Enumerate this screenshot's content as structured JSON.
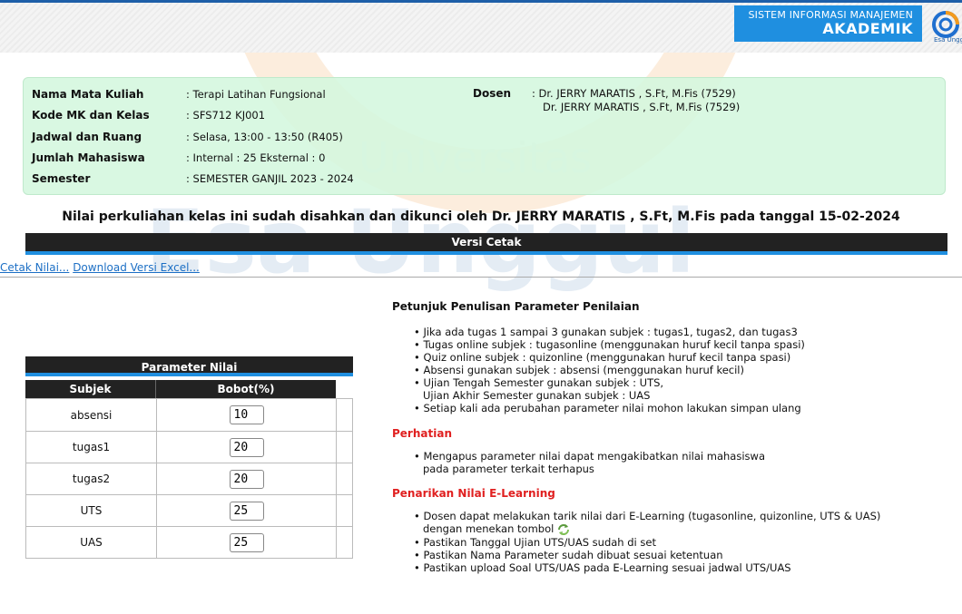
{
  "header": {
    "title_line1": "SISTEM INFORMASI MANAJEMEN",
    "title_line2": "AKADEMIK",
    "logo_text": "Esa Unggul",
    "accent": "#1f8fe0"
  },
  "watermark": {
    "line1": "Universitas",
    "line2": "Esa Unggul"
  },
  "info": {
    "rows": [
      {
        "label": "Nama Mata Kuliah",
        "value": ": Terapi Latihan Fungsional"
      },
      {
        "label": "Kode MK dan Kelas",
        "value": ": SFS712 KJ001"
      },
      {
        "label": "Jadwal dan Ruang",
        "value": ": Selasa, 13:00 - 13:50 (R405)"
      },
      {
        "label": "Jumlah Mahasiswa",
        "value": ": Internal : 25 Eksternal : 0"
      },
      {
        "label": "Semester",
        "value": ": SEMESTER GANJIL 2023 - 2024"
      }
    ],
    "dosen_label": "Dosen",
    "dosen_line1": ": Dr. JERRY MARATIS , S.Ft, M.Fis (7529)",
    "dosen_line2": "Dr. JERRY MARATIS , S.Ft, M.Fis (7529)"
  },
  "locked_message": "Nilai perkuliahan kelas ini sudah disahkan dan dikunci oleh Dr. JERRY MARATIS , S.Ft, M.Fis pada tanggal 15-02-2024",
  "versi_cetak": {
    "title": "Versi Cetak",
    "link_cetak": "Cetak Nilai...",
    "link_excel": "Download Versi Excel..."
  },
  "parameter": {
    "title": "Parameter Nilai",
    "col_subjek": "Subjek",
    "col_bobot": "Bobot(%)",
    "rows": [
      {
        "subjek": "absensi",
        "bobot": "10"
      },
      {
        "subjek": "tugas1",
        "bobot": "20"
      },
      {
        "subjek": "tugas2",
        "bobot": "20"
      },
      {
        "subjek": "UTS",
        "bobot": "25"
      },
      {
        "subjek": "UAS",
        "bobot": "25"
      }
    ]
  },
  "petunjuk": {
    "title": "Petunjuk Penulisan Parameter Penilaian",
    "items": [
      "Jika ada tugas 1 sampai 3 gunakan subjek : tugas1, tugas2, dan tugas3",
      "Tugas online subjek : tugasonline (menggunakan huruf kecil tanpa spasi)",
      "Quiz online subjek : quizonline (menggunakan huruf kecil tanpa spasi)",
      "Absensi gunakan subjek : absensi (menggunakan huruf kecil)",
      "Ujian Tengah Semester gunakan subjek : UTS,",
      "Setiap kali ada perubahan parameter nilai mohon lakukan simpan ulang"
    ],
    "item5_cont": "Ujian Akhir Semester gunakan subjek : UAS"
  },
  "perhatian": {
    "title": "Perhatian",
    "item": "Mengapus parameter nilai dapat mengakibatkan nilai mahasiswa",
    "item_cont": "pada parameter terkait terhapus"
  },
  "penarikan": {
    "title": "Penarikan Nilai E-Learning",
    "item1": "Dosen dapat melakukan tarik nilai dari E-Learning (tugasonline, quizonline, UTS & UAS)",
    "item1_cont": "dengan menekan tombol",
    "item2": "Pastikan Tanggal Ujian UTS/UAS sudah di set",
    "item3": "Pastikan Nama Parameter sudah dibuat sesuai ketentuan",
    "item4": "Pastikan upload Soal UTS/UAS pada E-Learning sesuai jadwal UTS/UAS"
  }
}
